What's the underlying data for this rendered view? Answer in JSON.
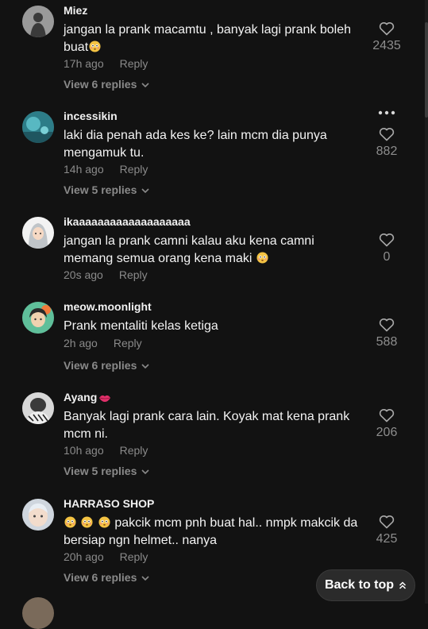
{
  "comments": [
    {
      "username": "Miez",
      "text": "jangan la prank macamtu , banyak lagi prank boleh buat",
      "emoji_after": true,
      "time": "17h ago",
      "reply": "Reply",
      "view_replies": "View 6 replies",
      "likes": "2435",
      "avatar": "grey-figure-avatar"
    },
    {
      "username": "incessikin",
      "text": "laki dia penah ada kes ke? lain mcm dia punya mengamuk tu.",
      "time": "14h ago",
      "reply": "Reply",
      "view_replies": "View 5 replies",
      "likes": "882",
      "avatar": "teal-landscape-avatar"
    },
    {
      "username": "ikaaaaaaaaaaaaaaaaaaa",
      "text": "jangan la prank camni kalau aku kena camni memang semua orang kena maki",
      "emoji_after": true,
      "time": "20s ago",
      "reply": "Reply",
      "view_replies": "",
      "likes": "0",
      "avatar": "hijab-cartoon-avatar"
    },
    {
      "username": "meow.moonlight",
      "text": "Prank mentaliti kelas ketiga",
      "time": "2h ago",
      "reply": "Reply",
      "view_replies": "View 6 replies",
      "likes": "588",
      "avatar": "green-cartoon-avatar"
    },
    {
      "username": "Ayang",
      "username_emoji": "lips",
      "text": "Banyak lagi prank cara lain. Koyak mat kena prank mcm ni.",
      "time": "10h ago",
      "reply": "Reply",
      "view_replies": "View 5 replies",
      "likes": "206",
      "avatar": "keffiyeh-avatar"
    },
    {
      "username": "HARRASO SHOP",
      "text_prefix_emojis": 3,
      "text": "pakcik mcm pnh buat hal.. nmpk makcik da bersiap ngn helmet.. nanya",
      "time": "20h ago",
      "reply": "Reply",
      "view_replies": "View 6 replies",
      "likes": "425",
      "avatar": "baby-avatar"
    }
  ],
  "back_to_top": "Back to top",
  "colors": {
    "background": "#121212",
    "muted": "#8a8a8a",
    "emoji": "#f4c343"
  }
}
